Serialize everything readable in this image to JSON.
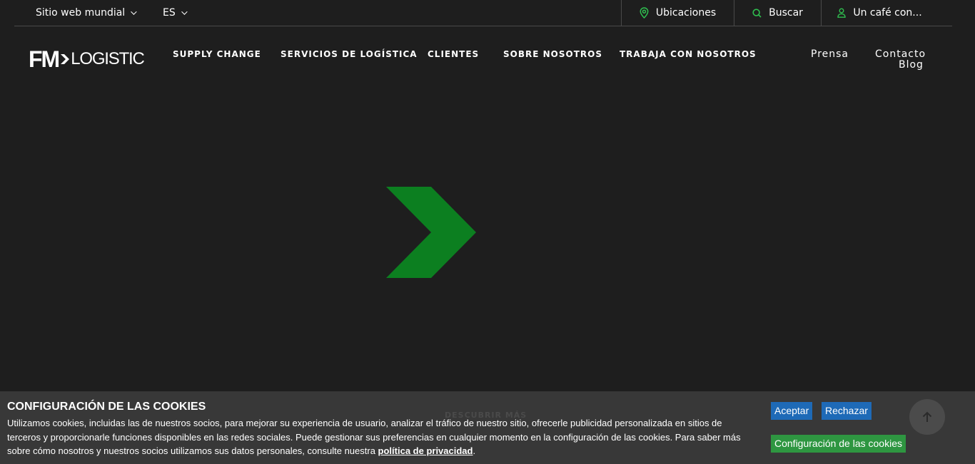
{
  "topbar": {
    "site_selector": "Sitio web mundial",
    "language": "ES",
    "locations": "Ubicaciones",
    "search": "Buscar",
    "coffee": "Un café con..."
  },
  "logo": {
    "fm": "FM",
    "word": "LOGISTIC"
  },
  "nav": {
    "items": [
      "SUPPLY CHANGE",
      "SERVICIOS DE LOGÍSTICA",
      "CLIENTES",
      "SOBRE NOSOTROS",
      "TRABAJA CON NOSOTROS"
    ],
    "press": "Prensa",
    "contact": "Contacto",
    "blog": "Blog"
  },
  "hero": {
    "discover": "DESCUBRIR MÁS"
  },
  "cookies": {
    "title": "CONFIGURACIÓN DE LAS COOKIES",
    "text": "Utilizamos cookies, incluidas las de nuestros socios, para mejorar su experiencia de usuario, analizar el tráfico de nuestro sitio, ofrecerle publicidad personalizada en sitios de terceros y proporcionarle funciones disponibles en las redes sociales. Puede gestionar sus preferencias en cualquier momento en la configuración de las cookies. Para saber más sobre cómo nosotros y nuestros socios utilizamos sus datos personales, consulte nuestra ",
    "policy_link": "política de privacidad",
    "text_end": ".",
    "accept": "Aceptar",
    "reject": "Rechazar",
    "settings": "Configuración de las cookies"
  },
  "colors": {
    "background": "#1e1e1e",
    "brand_green": "#0c7f20",
    "icon_green": "#2fbf4f",
    "button_blue": "#1e6ab7",
    "button_green": "#2e9641"
  },
  "icons": {
    "location": "map-pin-icon",
    "search": "search-icon",
    "user": "user-icon",
    "scroll_top": "arrow-up-icon"
  }
}
